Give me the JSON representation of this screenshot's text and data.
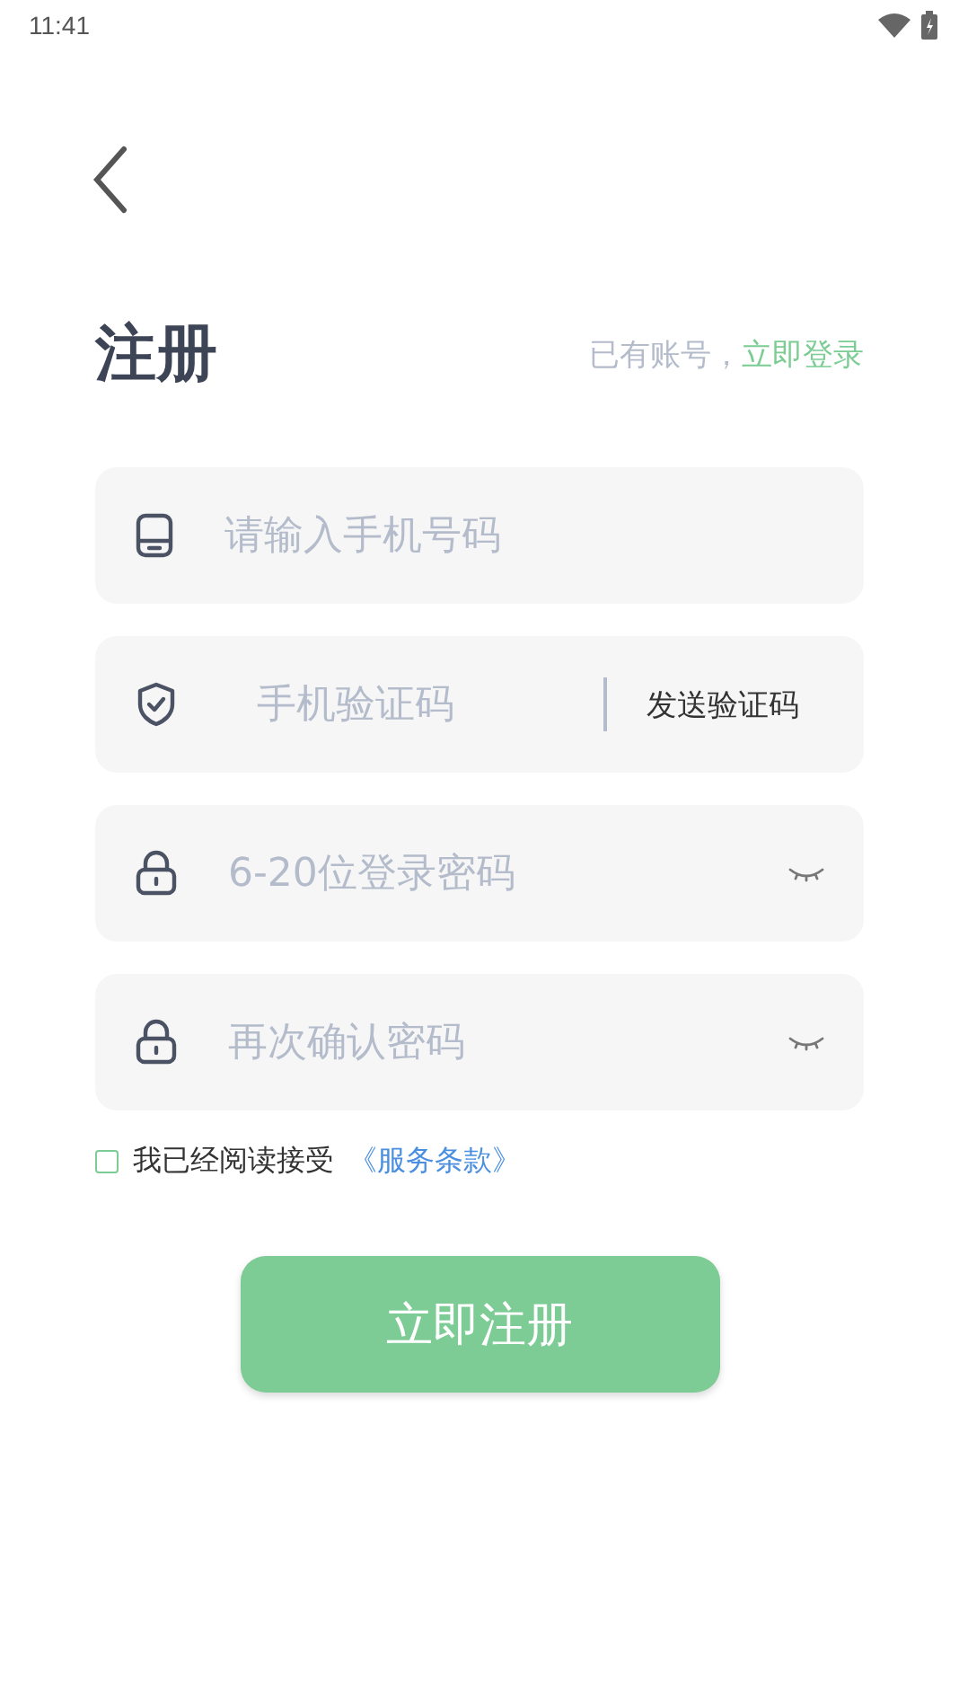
{
  "status_bar": {
    "time": "11:41"
  },
  "header": {
    "title": "注册",
    "prompt": "已有账号，",
    "login_link": "立即登录"
  },
  "fields": [
    {
      "kind": "phone",
      "placeholder": "请输入手机号码"
    },
    {
      "kind": "code",
      "placeholder": "手机验证码",
      "action": "发送验证码"
    },
    {
      "kind": "password",
      "placeholder": "6-20位登录密码",
      "eye": true
    },
    {
      "kind": "password",
      "placeholder": "再次确认密码",
      "eye": true
    }
  ],
  "agreement": {
    "checked": false,
    "text": "我已经阅读接受",
    "link": "《服务条款》"
  },
  "submit": {
    "label": "立即注册"
  }
}
